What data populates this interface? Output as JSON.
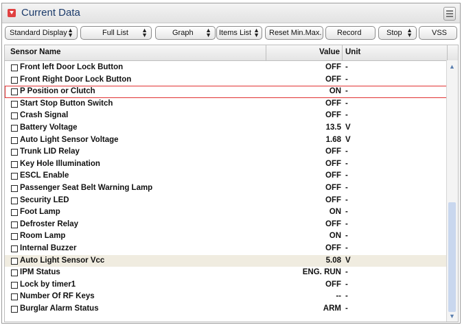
{
  "window": {
    "title": "Current Data"
  },
  "toolbar": {
    "standard_display": "Standard Display",
    "full_list": "Full List",
    "graph": "Graph",
    "items_list": "Items List",
    "reset": "Reset Min.Max.",
    "record": "Record",
    "stop": "Stop",
    "vss": "VSS"
  },
  "columns": {
    "name": "Sensor Name",
    "value": "Value",
    "unit": "Unit"
  },
  "rows": [
    {
      "name": "Front left Door Lock Button",
      "value": "OFF",
      "unit": "-"
    },
    {
      "name": "Front Right Door Lock Button",
      "value": "OFF",
      "unit": "-"
    },
    {
      "name": "P Position or Clutch",
      "value": "ON",
      "unit": "-"
    },
    {
      "name": "Start Stop Button Switch",
      "value": "OFF",
      "unit": "-"
    },
    {
      "name": "Crash Signal",
      "value": "OFF",
      "unit": "-"
    },
    {
      "name": "Battery Voltage",
      "value": "13.5",
      "unit": "V"
    },
    {
      "name": "Auto Light Sensor Voltage",
      "value": "1.68",
      "unit": "V"
    },
    {
      "name": "Trunk LID Relay",
      "value": "OFF",
      "unit": "-"
    },
    {
      "name": "Key Hole Illumination",
      "value": "OFF",
      "unit": "-"
    },
    {
      "name": "ESCL Enable",
      "value": "OFF",
      "unit": "-"
    },
    {
      "name": "Passenger Seat Belt Warning Lamp",
      "value": "OFF",
      "unit": "-"
    },
    {
      "name": "Security LED",
      "value": "OFF",
      "unit": "-"
    },
    {
      "name": "Foot Lamp",
      "value": "ON",
      "unit": "-"
    },
    {
      "name": "Defroster Relay",
      "value": "OFF",
      "unit": "-"
    },
    {
      "name": "Room Lamp",
      "value": "ON",
      "unit": "-"
    },
    {
      "name": "Internal Buzzer",
      "value": "OFF",
      "unit": "-"
    },
    {
      "name": "Auto Light Sensor Vcc",
      "value": "5.08",
      "unit": "V"
    },
    {
      "name": "IPM Status",
      "value": "ENG. RUN",
      "unit": "-"
    },
    {
      "name": "Lock by timer1",
      "value": "OFF",
      "unit": "-"
    },
    {
      "name": "Number Of RF Keys",
      "value": "--",
      "unit": "-"
    },
    {
      "name": "Burglar Alarm Status",
      "value": "ARM",
      "unit": "-"
    }
  ],
  "selected_row": "P Position or Clutch",
  "highlighted_row": "Auto Light Sensor Vcc",
  "colors": {
    "selection_border": "#e03030",
    "highlight_row": "#f0ece0",
    "title_text": "#1a3a6a",
    "scroll_thumb": "#c9d7ee"
  },
  "icons": {
    "title_icon": "collapse-icon",
    "menu": "menu-icon"
  }
}
